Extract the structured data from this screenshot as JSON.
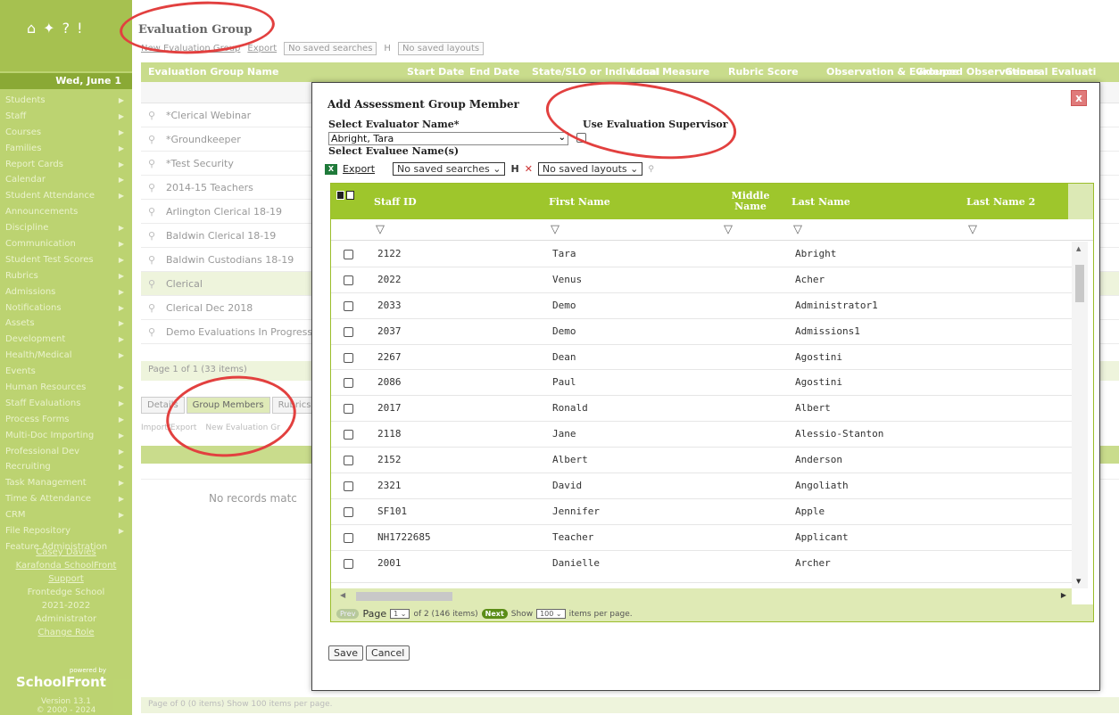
{
  "sidebar": {
    "date": "Wed, June 1",
    "items": [
      "Students",
      "Staff",
      "Courses",
      "Families",
      "Report Cards",
      "Calendar",
      "Student Attendance",
      "Announcements",
      "Discipline",
      "Communication",
      "Student Test Scores",
      "Rubrics",
      "Admissions",
      "Notifications",
      "Assets",
      "Development",
      "Health/Medical",
      "Events",
      "Human Resources",
      "Staff Evaluations",
      "Process Forms",
      "Multi-Doc Importing",
      "Professional Dev",
      "Recruiting",
      "Task Management",
      "Time & Attendance",
      "CRM",
      "File Repository",
      "Feature Administration"
    ],
    "user_name": "Casey Davies",
    "support_link": "Karafonda SchoolFront Support",
    "school": "Frontedge School",
    "year": "2021-2022",
    "role": "Administrator",
    "change_role": "Change Role",
    "logo_powered": "powered by",
    "logo": "SchoolFront",
    "version": "Version 13.1",
    "copyright": "© 2000 - 2024"
  },
  "background": {
    "page_title": "Evaluation Group",
    "new_group": "New Evaluation Group",
    "export": "Export",
    "saved_searches": "No saved searches",
    "saved_layouts": "No saved layouts",
    "columns": [
      "Evaluation Group Name",
      "Start Date",
      "End Date",
      "State/SLO or Individual",
      "Local Measure",
      "Rubric Score",
      "Observation & Evidence",
      "Grouped Observations",
      "General Evaluati"
    ],
    "rows": [
      "*Clerical Webinar",
      "*Groundkeeper",
      "*Test Security",
      "2014-15 Teachers",
      "Arlington Clerical 18-19",
      "Baldwin Clerical 18-19",
      "Baldwin Custodians 18-19",
      "Clerical",
      "Clerical Dec 2018",
      "Demo Evaluations In Progress"
    ],
    "pager": "Page 1 of 1 (33 items)",
    "tabs": [
      "Details",
      "Group Members",
      "Rubrics"
    ],
    "import_export": "Import/Export",
    "new_evaluation_group": "New Evaluation Gr",
    "no_records": "No records matc",
    "bottom_pager": "Page  of 0 (0 items)   Show 100 items per page."
  },
  "modal": {
    "title": "Add Assessment Group Member",
    "evaluator_label": "Select Evaluator Name*",
    "evaluator_value": "Abright, Tara",
    "use_supervisor_label": "Use Evaluation Supervisor",
    "evaluee_label": "Select Evaluee Name(s)",
    "export": "Export",
    "saved_searches": "No saved searches",
    "saved_layouts": "No saved layouts",
    "columns": {
      "staff_id": "Staff ID",
      "first_name": "First Name",
      "middle_name": "Middle Name",
      "last_name": "Last Name",
      "last_name_2": "Last Name 2"
    },
    "rows": [
      {
        "id": "2122",
        "first": "Tara",
        "last": "Abright"
      },
      {
        "id": "2022",
        "first": "Venus",
        "last": "Acher"
      },
      {
        "id": "2033",
        "first": "Demo",
        "last": "Administrator1"
      },
      {
        "id": "2037",
        "first": "Demo",
        "last": "Admissions1"
      },
      {
        "id": "2267",
        "first": "Dean",
        "last": "Agostini"
      },
      {
        "id": "2086",
        "first": "Paul",
        "last": "Agostini"
      },
      {
        "id": "2017",
        "first": "Ronald",
        "last": "Albert"
      },
      {
        "id": "2118",
        "first": "Jane",
        "last": "Alessio-Stanton"
      },
      {
        "id": "2152",
        "first": "Albert",
        "last": "Anderson"
      },
      {
        "id": "2321",
        "first": "David",
        "last": "Angoliath"
      },
      {
        "id": "SF101",
        "first": "Jennifer",
        "last": "Apple"
      },
      {
        "id": "NH1722685",
        "first": "Teacher",
        "last": "Applicant"
      },
      {
        "id": "2001",
        "first": "Danielle",
        "last": "Archer"
      }
    ],
    "pager": {
      "prev": "Prev",
      "page_word": "Page",
      "page_value": "1",
      "of_text": "of 2 (146 items)",
      "next": "Next",
      "show": "Show",
      "per_page_value": "100",
      "items_per_page": "items per page."
    },
    "save": "Save",
    "cancel": "Cancel",
    "close": "x"
  },
  "colors": {
    "sidebar_green": "#b5cf62",
    "header_green": "#9ec62c",
    "annotation_red": "#e2403f"
  }
}
